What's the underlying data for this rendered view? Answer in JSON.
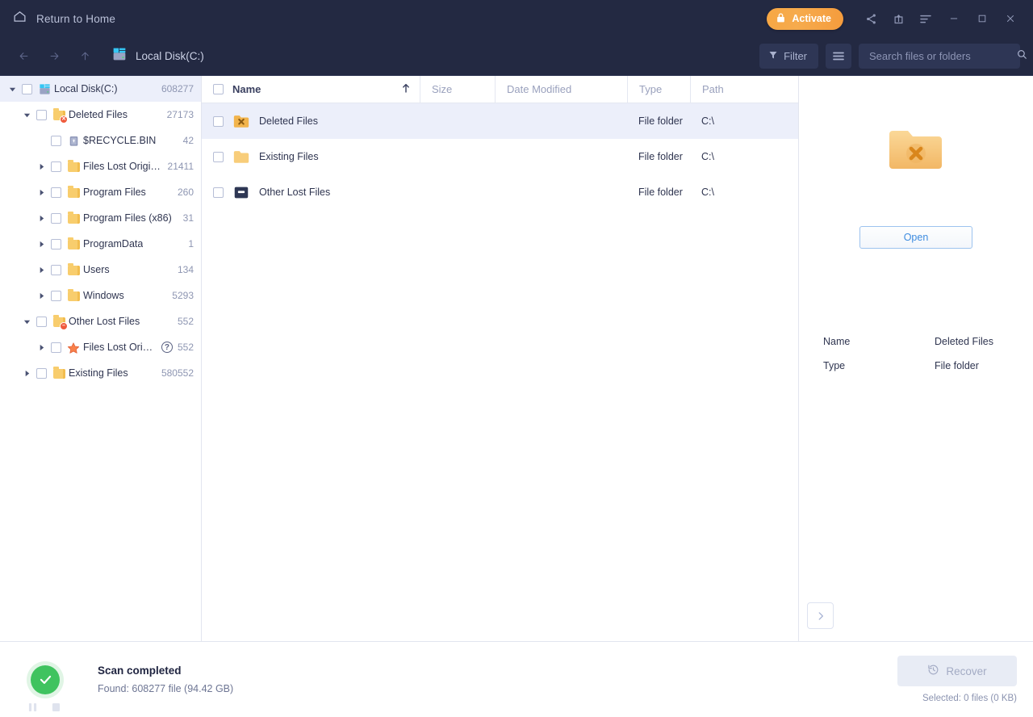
{
  "titlebar": {
    "home_label": "Return to Home",
    "home_icon": "home-icon",
    "activate_label": "Activate",
    "activate_icon": "lock-icon",
    "icons": [
      "share-icon",
      "export-icon",
      "menu-icon",
      "minimize-icon",
      "maximize-icon",
      "close-icon"
    ],
    "accent_color": "#f5a442",
    "bg_color": "#232942"
  },
  "toolbar": {
    "nav": [
      "back-arrow-icon",
      "forward-arrow-icon",
      "up-arrow-icon"
    ],
    "breadcrumb": "Local Disk(C:)",
    "breadcrumb_icon": "disk-icon",
    "filter_label": "Filter",
    "filter_icon": "funnel-icon",
    "hamburger_icon": "hamburger-icon",
    "search": {
      "placeholder": "Search files or folders",
      "value": "",
      "icon": "search-icon"
    }
  },
  "sidebar": {
    "items": [
      {
        "label": "Local Disk(C:)",
        "count": "608277",
        "depth": 0,
        "caret": "down",
        "icon": "disk",
        "selected": true
      },
      {
        "label": "Deleted Files",
        "count": "27173",
        "depth": 1,
        "caret": "down",
        "icon": "folder-deleted",
        "selected": false
      },
      {
        "label": "$RECYCLE.BIN",
        "count": "42",
        "depth": 2,
        "caret": "none",
        "icon": "recycle-bin",
        "selected": false
      },
      {
        "label": "Files Lost Original Di…",
        "count": "21411",
        "depth": 2,
        "caret": "right",
        "icon": "folder",
        "selected": false
      },
      {
        "label": "Program Files",
        "count": "260",
        "depth": 2,
        "caret": "right",
        "icon": "folder",
        "selected": false
      },
      {
        "label": "Program Files (x86)",
        "count": "31",
        "depth": 2,
        "caret": "right",
        "icon": "folder",
        "selected": false
      },
      {
        "label": "ProgramData",
        "count": "1",
        "depth": 2,
        "caret": "right",
        "icon": "folder",
        "selected": false
      },
      {
        "label": "Users",
        "count": "134",
        "depth": 2,
        "caret": "right",
        "icon": "folder",
        "selected": false
      },
      {
        "label": "Windows",
        "count": "5293",
        "depth": 2,
        "caret": "right",
        "icon": "folder",
        "selected": false
      },
      {
        "label": "Other Lost Files",
        "count": "552",
        "depth": 1,
        "caret": "down",
        "icon": "folder-lost",
        "selected": false
      },
      {
        "label": "Files Lost Original …",
        "count": "552",
        "depth": 2,
        "caret": "right",
        "icon": "star",
        "help": true,
        "selected": false
      },
      {
        "label": "Existing Files",
        "count": "580552",
        "depth": 1,
        "caret": "right",
        "icon": "folder",
        "selected": false
      }
    ]
  },
  "filelist": {
    "columns": [
      "Name",
      "Size",
      "Date Modified",
      "Type",
      "Path"
    ],
    "sort_column": "Name",
    "sort_direction": "asc",
    "sort_icon": "arrow-up-icon",
    "rows": [
      {
        "name": "Deleted Files",
        "size": "",
        "date": "",
        "type": "File folder",
        "path": "C:\\",
        "icon": "folder-x",
        "selected": true
      },
      {
        "name": "Existing Files",
        "size": "",
        "date": "",
        "type": "File folder",
        "path": "C:\\",
        "icon": "folder",
        "selected": false
      },
      {
        "name": "Other Lost Files",
        "size": "",
        "date": "",
        "type": "File folder",
        "path": "C:\\",
        "icon": "drive",
        "selected": false
      }
    ]
  },
  "preview": {
    "icon": "folder-x-large",
    "open_label": "Open",
    "meta": [
      {
        "key": "Name",
        "value": "Deleted Files"
      },
      {
        "key": "Type",
        "value": "File folder"
      }
    ],
    "expand_icon": "chevron-right-icon"
  },
  "statusbar": {
    "status_icon": "check-circle-icon",
    "status_title": "Scan completed",
    "status_sub": "Found: 608277 file (94.42 GB)",
    "media_icons": [
      "pause-icon",
      "stop-icon"
    ],
    "recover_label": "Recover",
    "recover_icon": "history-icon",
    "recover_enabled": false,
    "selected_text": "Selected: 0 files (0 KB)"
  }
}
